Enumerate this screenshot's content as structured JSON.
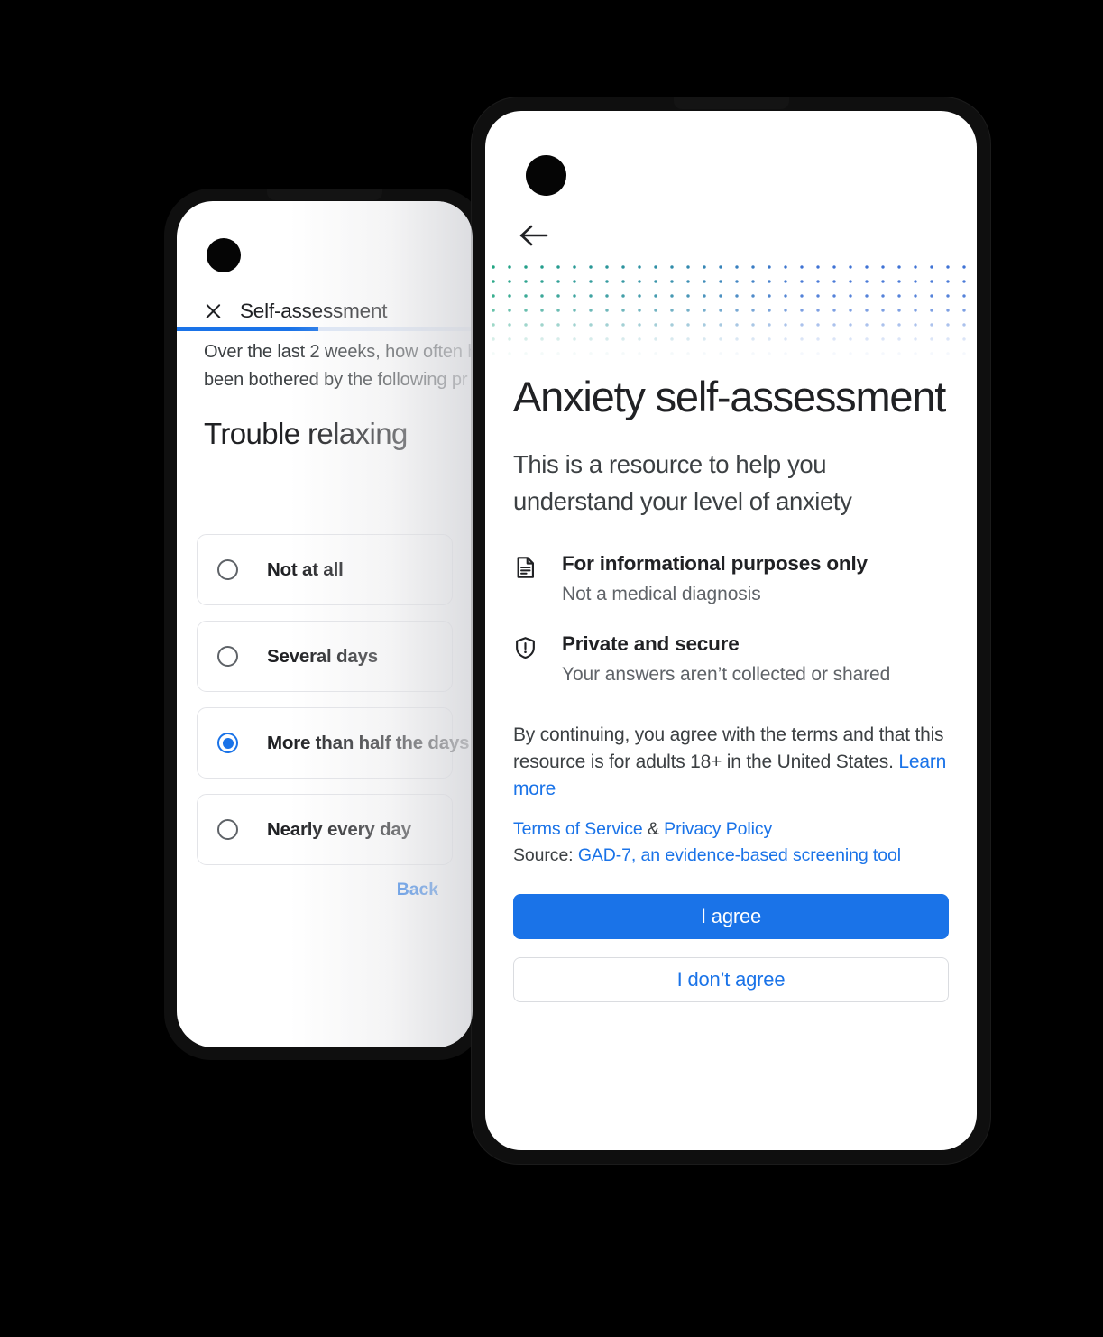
{
  "left_phone": {
    "header": {
      "close_icon": "close-icon",
      "title": "Self-assessment"
    },
    "progress": {
      "percent": 48
    },
    "question_intro_line1": "Over the last 2 weeks, how often h",
    "question_intro_line2": "been bothered by the following pr",
    "prompt": "Trouble relaxing",
    "options": [
      {
        "label": "Not at all",
        "selected": false
      },
      {
        "label": "Several days",
        "selected": false
      },
      {
        "label": "More than half the days",
        "selected": true
      },
      {
        "label": "Nearly every day",
        "selected": false
      }
    ],
    "back_label": "Back"
  },
  "right_phone": {
    "back_icon": "arrow-back-icon",
    "title": "Anxiety self-assessment",
    "subtitle": "This is a resource to help you understand your level of anxiety",
    "features": [
      {
        "icon": "document-icon",
        "title": "For informational purposes only",
        "desc": "Not a medical diagnosis"
      },
      {
        "icon": "shield-alert-icon",
        "title": "Private and secure",
        "desc": "Your answers aren’t collected or shared"
      }
    ],
    "legal": {
      "text": "By continuing, you agree with the terms and that this resource is for adults 18+ in the United States.",
      "learn_more": "Learn more",
      "terms": "Terms of Service",
      "amp": " & ",
      "privacy": "Privacy Policy",
      "source_label": "Source: ",
      "source_link": "GAD-7, an evidence-based screening tool"
    },
    "buttons": {
      "agree": "I agree",
      "disagree": "I don’t agree"
    }
  },
  "colors": {
    "accent_blue": "#1a73e8",
    "text_primary": "#202124",
    "text_secondary": "#5f6368",
    "dot_green": "#1aa678",
    "dot_blue": "#3b6fd4",
    "frame_black": "#0f0f0f"
  }
}
